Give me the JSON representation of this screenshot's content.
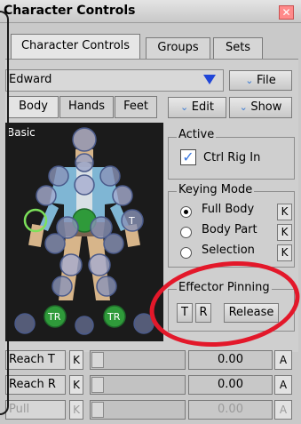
{
  "window": {
    "title": "Character Controls",
    "close_icon": "close-icon"
  },
  "tabs": [
    {
      "label": "Character Controls",
      "active": true
    },
    {
      "label": "Groups",
      "active": false
    },
    {
      "label": "Sets",
      "active": false
    }
  ],
  "character": {
    "selected": "Edward",
    "file_label": "File"
  },
  "body_tabs": [
    {
      "label": "Body",
      "active": true
    },
    {
      "label": "Hands",
      "active": false
    },
    {
      "label": "Feet",
      "active": false
    }
  ],
  "toolbar": {
    "edit_label": "Edit",
    "show_label": "Show"
  },
  "figure": {
    "mode_label": "Basic",
    "t_marker": "T",
    "tr_marker_left": "TR",
    "tr_marker_right": "TR"
  },
  "active": {
    "title": "Active",
    "ctrl_rig_in": "Ctrl Rig In",
    "checked": true
  },
  "keying_mode": {
    "title": "Keying Mode",
    "options": [
      "Full Body",
      "Body Part",
      "Selection"
    ],
    "selected": "Full Body",
    "key_label": "K"
  },
  "effector_pinning": {
    "title": "Effector Pinning",
    "t_label": "T",
    "r_label": "R",
    "release_label": "Release"
  },
  "rows": [
    {
      "label": "Reach T",
      "k": "K",
      "value": "0.00",
      "a": "A",
      "enabled": true
    },
    {
      "label": "Reach R",
      "k": "K",
      "value": "0.00",
      "a": "A",
      "enabled": true
    },
    {
      "label": "Pull",
      "k": "K",
      "value": "0.00",
      "a": "A",
      "enabled": false
    }
  ],
  "colors": {
    "highlight_circle": "#e3182a",
    "dropdown_arrow": "#2046d8",
    "effector_green": "#2f9a3a"
  }
}
